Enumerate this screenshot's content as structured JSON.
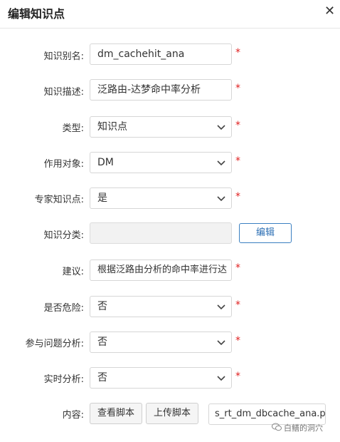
{
  "dialog": {
    "title": "编辑知识点"
  },
  "form": {
    "alias": {
      "label": "知识别名:",
      "value": "dm_cachehit_ana"
    },
    "description": {
      "label": "知识描述:",
      "value": "泛路由-达梦命中率分析"
    },
    "type": {
      "label": "类型:",
      "value": "知识点"
    },
    "target": {
      "label": "作用对象:",
      "value": "DM"
    },
    "expert": {
      "label": "专家知识点:",
      "value": "是"
    },
    "category": {
      "label": "知识分类:",
      "value": "",
      "edit_label": "编辑"
    },
    "suggestion": {
      "label": "建议:",
      "value": "根据泛路由分析的命中率进行达"
    },
    "danger": {
      "label": "是否危险:",
      "value": "否"
    },
    "problem_analysis": {
      "label": "参与问题分析:",
      "value": "否"
    },
    "realtime": {
      "label": "实时分析:",
      "value": "否"
    },
    "content": {
      "label": "内容:",
      "view_label": "查看脚本",
      "upload_label": "上传脚本",
      "file_name": "s_rt_dm_dbcache_ana.p"
    }
  },
  "required_mark": "*",
  "watermark": {
    "text": "白鳝的洞穴"
  },
  "colors": {
    "required": "#e02020",
    "edit_button": "#2c6fb4"
  }
}
